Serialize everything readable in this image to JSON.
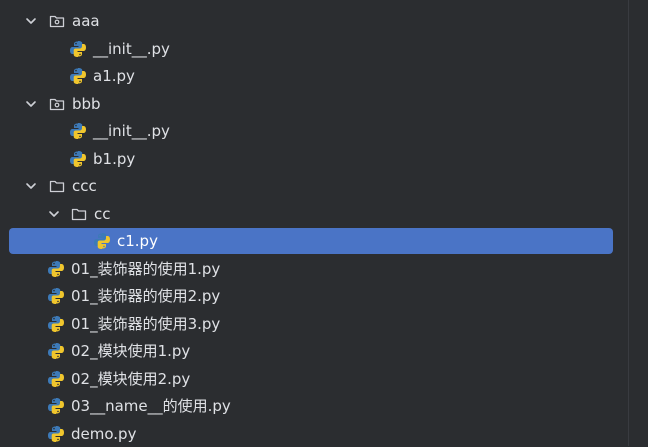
{
  "tree": {
    "items": [
      {
        "label": "aaa",
        "type": "package",
        "expanded": true
      },
      {
        "label": "__init__.py",
        "type": "python-file"
      },
      {
        "label": "a1.py",
        "type": "python-file"
      },
      {
        "label": "bbb",
        "type": "package",
        "expanded": true
      },
      {
        "label": "__init__.py",
        "type": "python-file"
      },
      {
        "label": "b1.py",
        "type": "python-file"
      },
      {
        "label": "ccc",
        "type": "folder",
        "expanded": true
      },
      {
        "label": "cc",
        "type": "folder",
        "expanded": true
      },
      {
        "label": "c1.py",
        "type": "python-file",
        "selected": true
      },
      {
        "label": "01_装饰器的使用1.py",
        "type": "python-file"
      },
      {
        "label": "01_装饰器的使用2.py",
        "type": "python-file"
      },
      {
        "label": "01_装饰器的使用3.py",
        "type": "python-file"
      },
      {
        "label": "02_模块使用1.py",
        "type": "python-file"
      },
      {
        "label": "02_模块使用2.py",
        "type": "python-file"
      },
      {
        "label": "03__name__的使用.py",
        "type": "python-file"
      },
      {
        "label": "demo.py",
        "type": "python-file"
      }
    ]
  },
  "colors": {
    "background": "#2b2d30",
    "selection": "#4a74c6",
    "text": "#dfe1e5",
    "python_blue": "#3d7ab8",
    "python_yellow": "#f0c62d"
  }
}
